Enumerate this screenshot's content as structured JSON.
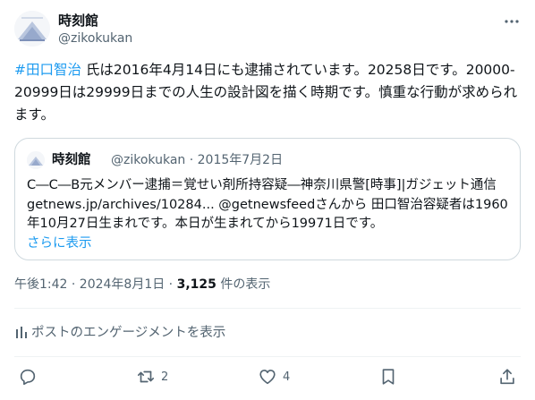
{
  "author": {
    "display_name": "時刻館",
    "handle": "@zikokukan"
  },
  "tweet": {
    "hashtag": "#田口智治",
    "text": " 氏は2016年4月14日にも逮捕されています。20258日です。20000-20999日は29999日までの人生の設計図を描く時期です。慎重な行動が求められます。"
  },
  "quote": {
    "display_name": "時刻館",
    "meta": "@zikokukan · 2015年7月2日",
    "text": "C―C―B元メンバー逮捕＝覚せい剤所持容疑―神奈川県警[時事]|ガジェット通信 getnews.jp/archives/10284... @getnewsfeedさんから 田口智治容疑者は1960年10月27日生まれです。本日が生まれてから19971日です。",
    "show_more": "さらに表示"
  },
  "meta": {
    "time_date": "午後1:42 · 2024年8月1日 · ",
    "views_count": "3,125",
    "views_label": " 件の表示"
  },
  "engagements_label": "ポストのエンゲージメントを表示",
  "actions": {
    "reply_count": "",
    "repost_count": "2",
    "like_count": "4"
  },
  "colors": {
    "accent": "#1d9bf0",
    "secondary_text": "#536471",
    "border": "#cfd9de"
  }
}
